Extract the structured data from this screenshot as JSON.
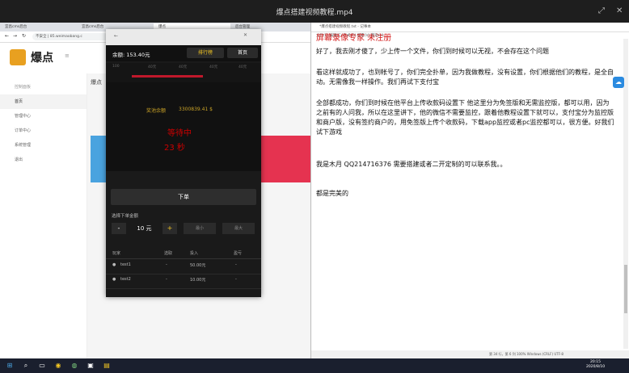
{
  "player": {
    "title": "爆点搭建视频教程.mp4"
  },
  "browser": {
    "tabs": [
      "宜昌cms后台",
      "宜昌cms后台",
      "爆点",
      "后台管理"
    ],
    "address": "不安全 | 85.weimaobang.c"
  },
  "site": {
    "logo_text": "爆点",
    "sidebar": [
      "控制面板",
      "首页",
      "管理中心",
      "订单中心",
      "系统管理",
      "退出"
    ],
    "main_label": "爆点"
  },
  "popup": {
    "balance": "余额: 153.40元",
    "rank_label": "排行榜",
    "home_label": "首页",
    "bet_numbers": [
      "100",
      "40元",
      "40元",
      "40元",
      "40元"
    ],
    "pool_label": "奖池余额",
    "pool_value": "3300839.41 $",
    "wait_line1": "等待中",
    "wait_line2": "23 秒",
    "order_button": "下单",
    "amount_label": "选择下单金额",
    "minus": "-",
    "quantity": "10 元",
    "plus": "+",
    "option_a": "最小",
    "option_b": "最大",
    "table_headers": [
      "玩家",
      "选取",
      "投入",
      "盈亏"
    ],
    "rows": [
      {
        "player": "test1",
        "pick": "-",
        "stake": "50.00元",
        "profit": "-"
      },
      {
        "player": "test2",
        "pick": "-",
        "stake": "10.00元",
        "profit": "-"
      }
    ]
  },
  "notepad": {
    "title": "*爆点搭建视频教程.txt - 记事本",
    "menu": "文件(F)  编辑(E)  格式(O)  查看(V)  帮助(H)",
    "watermark": "屏幕录像专家 未注册",
    "paragraphs": [
      "好了，我去刚才傻了，少上传一个文件，你们到时候可以无视，不会存在这个问题",
      "看这样就成功了，也到帐号了，你们完全扑单，因为我做教程，没有设置，你们根据他们的教程，是全自动。无需像我一样操作。我们再试下支付宝",
      "全部都成功，你们到时候在他平台上传收款码设置下 他这里分为免签版和无需监控版，都可以用，因为之前有的人问我，所以在这里讲下，他的微信不需要监控，跟着他教程设置下就可以，支付宝分为监控版和商户版，没有签约商户的，用免签版上传个收款码，下载app监控或者pc监控都可以，很方便。好我们试下游戏",
      "我是木月 QQ214716376 需要搭建或者二开定制的可以联系我。。",
      "都是完美的"
    ],
    "status": "第 34 行，第 6 列    100%    Windows (CRLF)    UTF-8"
  },
  "taskbar": {
    "time": "20:15",
    "date": "2020/8/10"
  }
}
